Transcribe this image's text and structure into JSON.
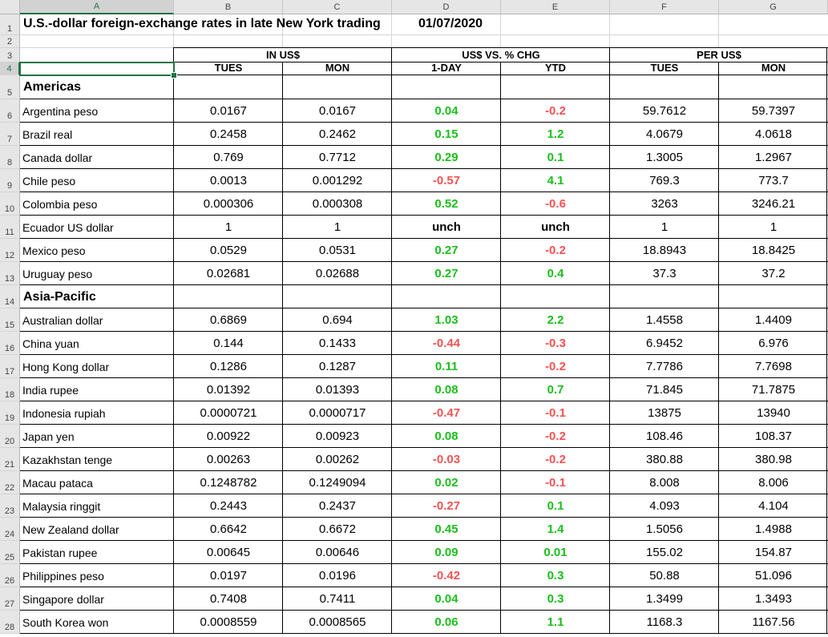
{
  "columns": [
    "A",
    "B",
    "C",
    "D",
    "E",
    "F",
    "G"
  ],
  "title": "U.S.-dollar foreign-exchange rates in late New York trading",
  "date": "01/07/2020",
  "groups": [
    "IN US$",
    "US$ VS. % CHG",
    "PER US$"
  ],
  "subheaders": [
    "TUES",
    "MON",
    "1-DAY",
    "YTD",
    "TUES",
    "MON"
  ],
  "sections": {
    "americas": "Americas",
    "asia": "Asia-Pacific"
  },
  "rows": [
    {
      "num": "6",
      "name": "Argentina peso",
      "b": "0.0167",
      "c": "0.0167",
      "d": "0.04",
      "e": "-0.2",
      "f": "59.7612",
      "g": "59.7397"
    },
    {
      "num": "7",
      "name": "Brazil real",
      "b": "0.2458",
      "c": "0.2462",
      "d": "0.15",
      "e": "1.2",
      "f": "4.0679",
      "g": "4.0618"
    },
    {
      "num": "8",
      "name": "Canada dollar",
      "b": "0.769",
      "c": "0.7712",
      "d": "0.29",
      "e": "0.1",
      "f": "1.3005",
      "g": "1.2967"
    },
    {
      "num": "9",
      "name": "Chile peso",
      "b": "0.0013",
      "c": "0.001292",
      "d": "-0.57",
      "e": "4.1",
      "f": "769.3",
      "g": "773.7"
    },
    {
      "num": "10",
      "name": "Colombia peso",
      "b": "0.000306",
      "c": "0.000308",
      "d": "0.52",
      "e": "-0.6",
      "f": "3263",
      "g": "3246.21"
    },
    {
      "num": "11",
      "name": "Ecuador US dollar",
      "b": "1",
      "c": "1",
      "d": "unch",
      "e": "unch",
      "f": "1",
      "g": "1"
    },
    {
      "num": "12",
      "name": "Mexico peso",
      "b": "0.0529",
      "c": "0.0531",
      "d": "0.27",
      "e": "-0.2",
      "f": "18.8943",
      "g": "18.8425"
    },
    {
      "num": "13",
      "name": "Uruguay peso",
      "b": "0.02681",
      "c": "0.02688",
      "d": "0.27",
      "e": "0.4",
      "f": "37.3",
      "g": "37.2"
    },
    {
      "num": "15",
      "name": "Australian dollar",
      "b": "0.6869",
      "c": "0.694",
      "d": "1.03",
      "e": "2.2",
      "f": "1.4558",
      "g": "1.4409"
    },
    {
      "num": "16",
      "name": "China yuan",
      "b": "0.144",
      "c": "0.1433",
      "d": "-0.44",
      "e": "-0.3",
      "f": "6.9452",
      "g": "6.976"
    },
    {
      "num": "17",
      "name": "Hong Kong dollar",
      "b": "0.1286",
      "c": "0.1287",
      "d": "0.11",
      "e": "-0.2",
      "f": "7.7786",
      "g": "7.7698"
    },
    {
      "num": "18",
      "name": "India rupee",
      "b": "0.01392",
      "c": "0.01393",
      "d": "0.08",
      "e": "0.7",
      "f": "71.845",
      "g": "71.7875"
    },
    {
      "num": "19",
      "name": "Indonesia rupiah",
      "b": "0.0000721",
      "c": "0.0000717",
      "d": "-0.47",
      "e": "-0.1",
      "f": "13875",
      "g": "13940"
    },
    {
      "num": "20",
      "name": "Japan yen",
      "b": "0.00922",
      "c": "0.00923",
      "d": "0.08",
      "e": "-0.2",
      "f": "108.46",
      "g": "108.37"
    },
    {
      "num": "21",
      "name": "Kazakhstan tenge",
      "b": "0.00263",
      "c": "0.00262",
      "d": "-0.03",
      "e": "-0.2",
      "f": "380.88",
      "g": "380.98"
    },
    {
      "num": "22",
      "name": "Macau pataca",
      "b": "0.1248782",
      "c": "0.1249094",
      "d": "0.02",
      "e": "-0.1",
      "f": "8.008",
      "g": "8.006"
    },
    {
      "num": "23",
      "name": "Malaysia ringgit",
      "b": "0.2443",
      "c": "0.2437",
      "d": "-0.27",
      "e": "0.1",
      "f": "4.093",
      "g": "4.104"
    },
    {
      "num": "24",
      "name": "New Zealand dollar",
      "b": "0.6642",
      "c": "0.6672",
      "d": "0.45",
      "e": "1.4",
      "f": "1.5056",
      "g": "1.4988"
    },
    {
      "num": "25",
      "name": "Pakistan rupee",
      "b": "0.00645",
      "c": "0.00646",
      "d": "0.09",
      "e": "0.01",
      "f": "155.02",
      "g": "154.87"
    },
    {
      "num": "26",
      "name": "Philippines peso",
      "b": "0.0197",
      "c": "0.0196",
      "d": "-0.42",
      "e": "0.3",
      "f": "50.88",
      "g": "51.096"
    },
    {
      "num": "27",
      "name": "Singapore dollar",
      "b": "0.7408",
      "c": "0.7411",
      "d": "0.04",
      "e": "0.3",
      "f": "1.3499",
      "g": "1.3493"
    },
    {
      "num": "28",
      "name": "South Korea won",
      "b": "0.0008559",
      "c": "0.0008565",
      "d": "0.06",
      "e": "1.1",
      "f": "1168.3",
      "g": "1167.56"
    }
  ],
  "colors": {
    "positive": "#1bbf1b",
    "negative": "#f05454",
    "selection": "#217346"
  }
}
